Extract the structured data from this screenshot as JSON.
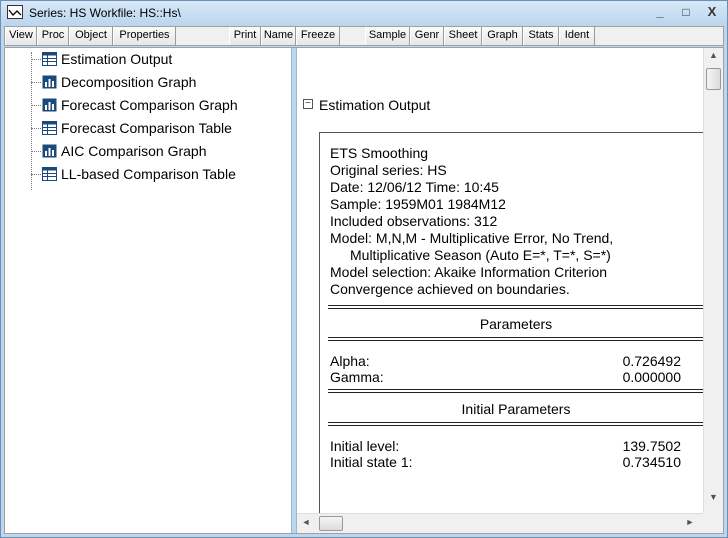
{
  "window": {
    "title": "Series: HS   Workfile: HS::Hs\\",
    "minimize": "_",
    "maximize": "□",
    "close": "X"
  },
  "toolbar": {
    "buttons": [
      "View",
      "Proc",
      "Object",
      "Properties",
      "Print",
      "Name",
      "Freeze",
      "Sample",
      "Genr",
      "Sheet",
      "Graph",
      "Stats",
      "Ident"
    ]
  },
  "tree": {
    "items": [
      {
        "label": "Estimation Output",
        "icon": "table-icon"
      },
      {
        "label": "Decomposition Graph",
        "icon": "graph-icon"
      },
      {
        "label": "Forecast Comparison Graph",
        "icon": "graph-icon"
      },
      {
        "label": "Forecast Comparison Table",
        "icon": "table-icon"
      },
      {
        "label": "AIC Comparison Graph",
        "icon": "graph-icon"
      },
      {
        "label": "LL-based Comparison Table",
        "icon": "table-icon"
      }
    ]
  },
  "output": {
    "collapse_glyph": "−",
    "section_title": "Estimation Output",
    "lines": [
      "ETS Smoothing",
      "Original series: HS",
      "Date: 12/06/12   Time: 10:45",
      "Sample: 1959M01 1984M12",
      "Included observations: 312",
      "Model: M,N,M - Multiplicative Error, No Trend,",
      "Multiplicative Season (Auto E=*, T=*, S=*)",
      "Model selection: Akaike Information Criterion",
      "Convergence achieved on boundaries."
    ],
    "parameters_header": "Parameters",
    "parameters": [
      {
        "name": "Alpha:",
        "value": "0.726492"
      },
      {
        "name": "Gamma:",
        "value": "0.000000"
      }
    ],
    "initial_header": "Initial Parameters",
    "initial": [
      {
        "name": "Initial level:",
        "value": "139.7502"
      },
      {
        "name": "Initial state 1:",
        "value": "0.734510"
      }
    ]
  },
  "scrollbars": {
    "up": "▲",
    "down": "▼",
    "left": "◄",
    "right": "►"
  }
}
